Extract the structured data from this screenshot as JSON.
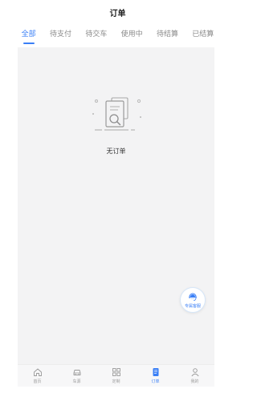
{
  "header": {
    "title": "订单"
  },
  "tabs": [
    {
      "label": "全部",
      "active": true
    },
    {
      "label": "待支付",
      "active": false
    },
    {
      "label": "待交车",
      "active": false
    },
    {
      "label": "使用中",
      "active": false
    },
    {
      "label": "待结算",
      "active": false
    },
    {
      "label": "已结算",
      "active": false
    }
  ],
  "empty_state": {
    "icon": "document-search-icon",
    "text": "无订单"
  },
  "customer_service": {
    "icon": "agent-icon",
    "label": "专属客服"
  },
  "bottom_nav": [
    {
      "label": "首页",
      "icon": "home-icon",
      "active": false
    },
    {
      "label": "车源",
      "icon": "car-icon",
      "active": false
    },
    {
      "label": "定制",
      "icon": "grid-icon",
      "active": false
    },
    {
      "label": "订单",
      "icon": "order-icon",
      "active": true
    },
    {
      "label": "我的",
      "icon": "user-icon",
      "active": false
    }
  ],
  "colors": {
    "accent": "#3a7ff6",
    "content_bg": "#f3f3f4",
    "inactive": "#9a9a9a"
  }
}
